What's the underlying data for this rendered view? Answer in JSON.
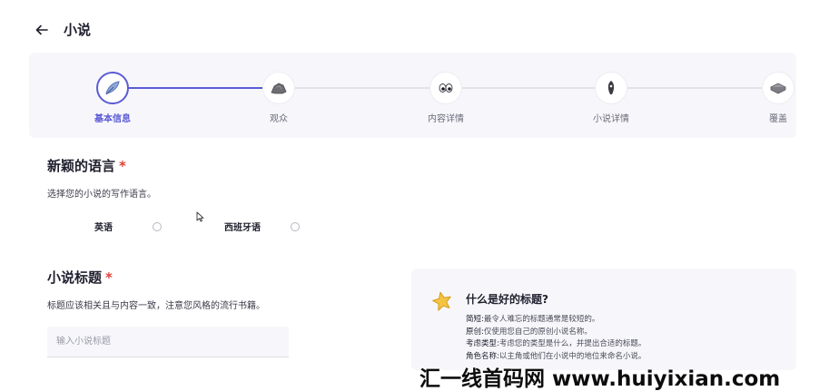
{
  "header": {
    "title": "小说"
  },
  "stepper": {
    "steps": [
      {
        "label": "基本信息",
        "icon": "feather-icon",
        "current": true
      },
      {
        "label": "观众",
        "icon": "rock-icon",
        "current": false
      },
      {
        "label": "内容详情",
        "icon": "eyes-icon",
        "current": false
      },
      {
        "label": "小说详情",
        "icon": "pen-nib-icon",
        "current": false
      },
      {
        "label": "覆盖",
        "icon": "book-stack-icon",
        "current": false
      }
    ]
  },
  "language": {
    "title": "新颖的语言",
    "required_mark": "*",
    "description": "选择您的小说的写作语言。",
    "options": [
      {
        "label": "英语",
        "selected": false
      },
      {
        "label": "西班牙语",
        "selected": false
      }
    ]
  },
  "novel_title": {
    "title": "小说标题",
    "required_mark": "*",
    "description": "标题应该相关且与内容一致，注意您风格的流行书籍。",
    "placeholder": "输入小说标题",
    "value": ""
  },
  "tip": {
    "icon": "star-icon",
    "title": "什么是好的标题?",
    "items": [
      {
        "key": "简短:",
        "text": "最令人难忘的标题通常是较短的。"
      },
      {
        "key": "原创:",
        "text": "仅使用您自己的原创小说名称。"
      },
      {
        "key": "考虑类型:",
        "text": "考虑您的类型是什么，并提出合适的标题。"
      },
      {
        "key": "角色名称:",
        "text": "以主角或他们在小说中的地位来命名小说。"
      }
    ]
  },
  "watermark": {
    "text": "汇一线首码网 www.huiyixian.com"
  },
  "colors": {
    "accent": "#5b5bd6",
    "required": "#e0413a",
    "panel": "#f7f7fb"
  }
}
